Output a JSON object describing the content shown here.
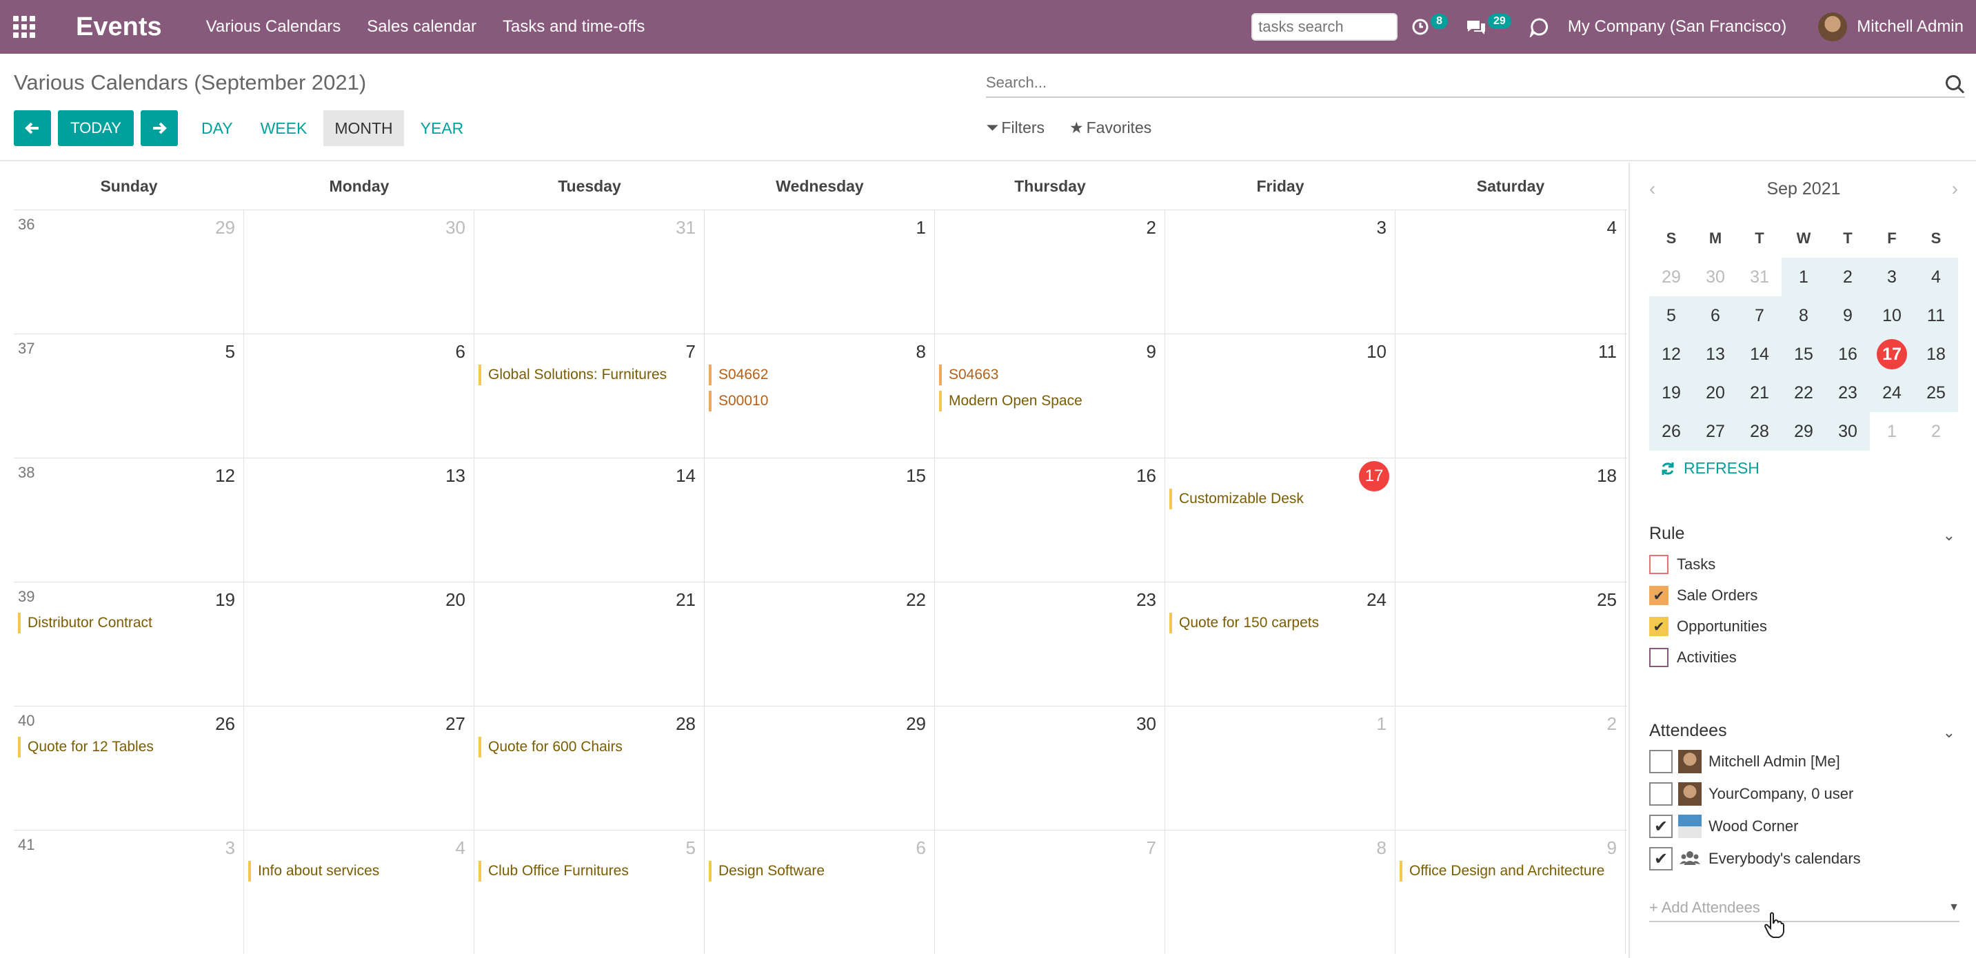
{
  "navbar": {
    "brand": "Events",
    "menus": [
      "Various Calendars",
      "Sales calendar",
      "Tasks and time-offs"
    ],
    "tasks_search_placeholder": "tasks search",
    "activities_count": "8",
    "messages_count": "29",
    "company": "My Company (San Francisco)",
    "user": "Mitchell Admin"
  },
  "control": {
    "breadcrumb": "Various Calendars (September 2021)",
    "today_label": "TODAY",
    "scales": [
      "DAY",
      "WEEK",
      "MONTH",
      "YEAR"
    ],
    "active_scale": "MONTH",
    "search_placeholder": "Search...",
    "filters_label": "Filters",
    "favorites_label": "Favorites"
  },
  "calendar": {
    "days_of_week": [
      "Sunday",
      "Monday",
      "Tuesday",
      "Wednesday",
      "Thursday",
      "Friday",
      "Saturday"
    ],
    "weeks": [
      {
        "number": "36",
        "days": [
          {
            "d": "29",
            "muted": true,
            "events": []
          },
          {
            "d": "30",
            "muted": true,
            "events": []
          },
          {
            "d": "31",
            "muted": true,
            "events": []
          },
          {
            "d": "1",
            "events": []
          },
          {
            "d": "2",
            "events": []
          },
          {
            "d": "3",
            "events": []
          },
          {
            "d": "4",
            "events": []
          }
        ]
      },
      {
        "number": "37",
        "days": [
          {
            "d": "5",
            "events": []
          },
          {
            "d": "6",
            "events": []
          },
          {
            "d": "7",
            "events": [
              {
                "t": "Global Solutions: Furnitures",
                "c": "yellow"
              }
            ]
          },
          {
            "d": "8",
            "events": [
              {
                "t": "S04662",
                "c": "orange"
              },
              {
                "t": "S00010",
                "c": "orange"
              }
            ]
          },
          {
            "d": "9",
            "events": [
              {
                "t": "S04663",
                "c": "orange"
              },
              {
                "t": "Modern Open Space",
                "c": "yellow"
              }
            ]
          },
          {
            "d": "10",
            "events": []
          },
          {
            "d": "11",
            "events": []
          }
        ]
      },
      {
        "number": "38",
        "days": [
          {
            "d": "12",
            "events": []
          },
          {
            "d": "13",
            "events": []
          },
          {
            "d": "14",
            "events": []
          },
          {
            "d": "15",
            "events": []
          },
          {
            "d": "16",
            "events": []
          },
          {
            "d": "17",
            "today": true,
            "events": [
              {
                "t": "Customizable Desk",
                "c": "yellow"
              }
            ]
          },
          {
            "d": "18",
            "events": []
          }
        ]
      },
      {
        "number": "39",
        "days": [
          {
            "d": "19",
            "events": [
              {
                "t": "Distributor Contract",
                "c": "yellow"
              }
            ]
          },
          {
            "d": "20",
            "events": []
          },
          {
            "d": "21",
            "events": []
          },
          {
            "d": "22",
            "events": []
          },
          {
            "d": "23",
            "events": []
          },
          {
            "d": "24",
            "events": [
              {
                "t": "Quote for 150 carpets",
                "c": "yellow"
              }
            ]
          },
          {
            "d": "25",
            "events": []
          }
        ]
      },
      {
        "number": "40",
        "days": [
          {
            "d": "26",
            "events": [
              {
                "t": "Quote for 12 Tables",
                "c": "yellow"
              }
            ]
          },
          {
            "d": "27",
            "events": []
          },
          {
            "d": "28",
            "events": [
              {
                "t": "Quote for 600 Chairs",
                "c": "yellow"
              }
            ]
          },
          {
            "d": "29",
            "events": []
          },
          {
            "d": "30",
            "events": []
          },
          {
            "d": "1",
            "muted": true,
            "events": []
          },
          {
            "d": "2",
            "muted": true,
            "events": []
          }
        ]
      },
      {
        "number": "41",
        "days": [
          {
            "d": "3",
            "muted": true,
            "events": []
          },
          {
            "d": "4",
            "muted": true,
            "events": [
              {
                "t": "Info about services",
                "c": "yellow"
              }
            ]
          },
          {
            "d": "5",
            "muted": true,
            "events": [
              {
                "t": "Club Office Furnitures",
                "c": "yellow"
              }
            ]
          },
          {
            "d": "6",
            "muted": true,
            "events": [
              {
                "t": "Design Software",
                "c": "yellow"
              }
            ]
          },
          {
            "d": "7",
            "muted": true,
            "events": []
          },
          {
            "d": "8",
            "muted": true,
            "events": []
          },
          {
            "d": "9",
            "muted": true,
            "events": [
              {
                "t": "Office Design and Architecture",
                "c": "yellow"
              }
            ]
          }
        ]
      }
    ]
  },
  "sidebar": {
    "mini_title": "Sep 2021",
    "mini_dow": [
      "S",
      "M",
      "T",
      "W",
      "T",
      "F",
      "S"
    ],
    "mini_weeks": [
      [
        "29",
        "30",
        "31",
        "1",
        "2",
        "3",
        "4"
      ],
      [
        "5",
        "6",
        "7",
        "8",
        "9",
        "10",
        "11"
      ],
      [
        "12",
        "13",
        "14",
        "15",
        "16",
        "17",
        "18"
      ],
      [
        "19",
        "20",
        "21",
        "22",
        "23",
        "24",
        "25"
      ],
      [
        "26",
        "27",
        "28",
        "29",
        "30",
        "1",
        "2"
      ]
    ],
    "refresh_label": "REFRESH",
    "rule_title": "Rule",
    "rules": [
      {
        "label": "Tasks",
        "checked": false,
        "color": "#e57373"
      },
      {
        "label": "Sale Orders",
        "checked": true,
        "color": "#f0a95a"
      },
      {
        "label": "Opportunities",
        "checked": true,
        "color": "#f2c94c"
      },
      {
        "label": "Activities",
        "checked": false,
        "color": "#875a7b"
      }
    ],
    "attendees_title": "Attendees",
    "attendees": [
      {
        "label": "Mitchell Admin [Me]",
        "checked": false,
        "icon": "avatar"
      },
      {
        "label": "YourCompany, 0 user",
        "checked": false,
        "icon": "avatar"
      },
      {
        "label": "Wood Corner",
        "checked": true,
        "icon": "company-logo"
      },
      {
        "label": "Everybody's calendars",
        "checked": true,
        "icon": "users-icon"
      }
    ],
    "add_attendees_placeholder": "+ Add Attendees"
  }
}
